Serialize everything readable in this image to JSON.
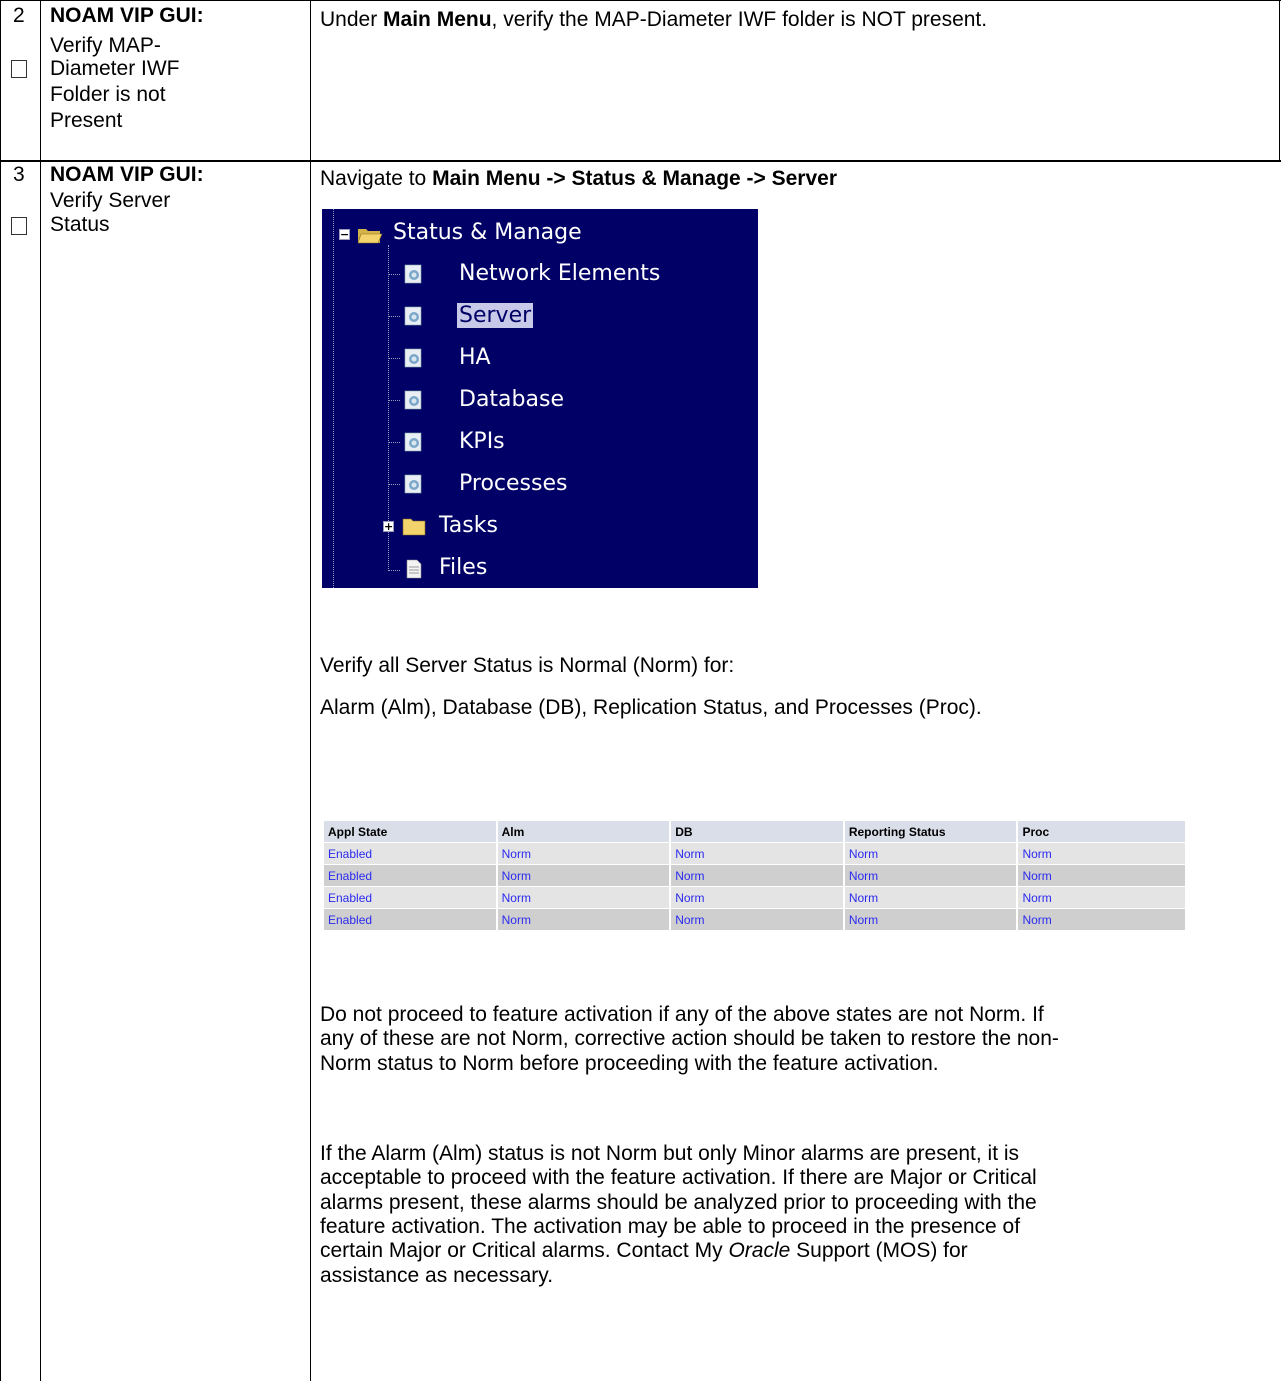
{
  "steps": [
    {
      "number": "2",
      "title_bold": "NOAM VIP GUI:",
      "title_lines": [
        "Verify MAP-",
        "Diameter IWF",
        "Folder is not",
        "Present"
      ],
      "instruction": {
        "prefix": "Under ",
        "bold": "Main Menu",
        "suffix": ", verify the MAP-Diameter IWF folder is NOT present."
      }
    },
    {
      "number": "3",
      "title_bold": "NOAM VIP GUI:",
      "title_lines": [
        "Verify Server",
        "Status"
      ],
      "instruction": {
        "prefix": "Navigate to ",
        "bold": "Main Menu -> Status & Manage -> Server"
      },
      "tree": {
        "root": "Status & Manage",
        "items": [
          "Network Elements",
          "Server",
          "HA",
          "Database",
          "KPIs",
          "Processes"
        ],
        "subfolder": "Tasks",
        "file": "Files",
        "selected": "Server"
      },
      "verify_line1": "Verify all Server Status is Normal (Norm) for:",
      "verify_line2": "Alarm (Alm),  Database (DB), Replication Status, and Processes (Proc).",
      "status_table": {
        "headers": [
          "Appl State",
          "Alm",
          "DB",
          "Reporting Status",
          "Proc"
        ],
        "rows": [
          [
            "Enabled",
            "Norm",
            "Norm",
            "Norm",
            "Norm"
          ],
          [
            "Enabled",
            "Norm",
            "Norm",
            "Norm",
            "Norm"
          ],
          [
            "Enabled",
            "Norm",
            "Norm",
            "Norm",
            "Norm"
          ],
          [
            "Enabled",
            "Norm",
            "Norm",
            "Norm",
            "Norm"
          ]
        ]
      },
      "note1_lines": [
        "Do not proceed to feature activation if any of the above states are not Norm. If",
        "any of these are not Norm, corrective action should be taken to restore the non-",
        "Norm status to Norm before proceeding with the feature activation."
      ],
      "note2_lines": [
        "If the Alarm (Alm) status is not Norm but only Minor alarms are present, it is",
        "acceptable to proceed with the feature activation.  If there are Major or Critical",
        "alarms present, these alarms should be analyzed prior to proceeding with the",
        "feature activation.  The activation may be able to proceed in the presence of",
        "certain Major or Critical alarms.  Contact My "
      ],
      "note2_italic": "Oracle",
      "note2_after_italic": " Support (MOS)  for",
      "note2_last": "assistance as necessary."
    }
  ]
}
